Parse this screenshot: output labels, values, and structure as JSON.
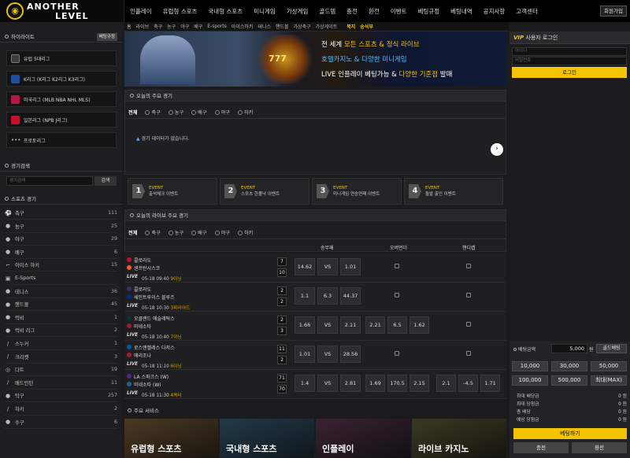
{
  "header": {
    "logo_line1": "ANOTHER",
    "logo_line2": "LEVEL",
    "nav": [
      "인플레이",
      "유럽형 스포츠",
      "국내형 스포츠",
      "미니게임",
      "가상게임",
      "골드뎀",
      "충전",
      "환전",
      "이벤트",
      "베팅규정",
      "베팅내역",
      "공지사항",
      "고객센터"
    ],
    "join_label": "회원가입"
  },
  "subnav": {
    "items": [
      "홈",
      "라이브",
      "축구",
      "농구",
      "야구",
      "배구",
      "E-sports",
      "아이스하키",
      "테니스",
      "핸드볼",
      "가상축구",
      "가상게이트"
    ],
    "highlight": [
      "복지",
      "승석부"
    ]
  },
  "left": {
    "highlight_title": "하이라이트",
    "highlight_badge": "베팅규정",
    "leagues": [
      "유럽 5대리그",
      "K리그 (K리그 K2리그 K3리그)",
      "미국리그 (MLB NBA NHL MLS)",
      "일본리그 (NPB J리그)",
      "프로토리그"
    ],
    "search_title": "경기검색",
    "search_placeholder": "경기검색",
    "search_btn": "검색",
    "sports_title": "스포츠 경기",
    "sports": [
      {
        "name": "축구",
        "count": "111",
        "icon": "⚽"
      },
      {
        "name": "농구",
        "count": "25",
        "icon": "●"
      },
      {
        "name": "야구",
        "count": "29",
        "icon": "●"
      },
      {
        "name": "배구",
        "count": "6",
        "icon": "●"
      },
      {
        "name": "아이스 하키",
        "count": "15",
        "icon": "⌐"
      },
      {
        "name": "E-Sports",
        "count": "",
        "icon": "▣"
      },
      {
        "name": "테니스",
        "count": "36",
        "icon": "●"
      },
      {
        "name": "핸드볼",
        "count": "45",
        "icon": "●"
      },
      {
        "name": "럭비",
        "count": "1",
        "icon": "●"
      },
      {
        "name": "럭비 리그",
        "count": "2",
        "icon": "●"
      },
      {
        "name": "스누커",
        "count": "1",
        "icon": "/"
      },
      {
        "name": "크리켓",
        "count": "3",
        "icon": "/"
      },
      {
        "name": "다트",
        "count": "19",
        "icon": "◎"
      },
      {
        "name": "배드민턴",
        "count": "11",
        "icon": "/"
      },
      {
        "name": "탁구",
        "count": "257",
        "icon": "●"
      },
      {
        "name": "하키",
        "count": "2",
        "icon": "/"
      },
      {
        "name": "수구",
        "count": "6",
        "icon": "●"
      }
    ]
  },
  "banner": {
    "line1_a": "전 세계 ",
    "line1_b": "모든 스포츠 & 정식 라이브",
    "line2": "호텔카지노 & 다양한 미니게임",
    "line3_a": "LIVE 인플레이 ",
    "line3_b": "베팅가능 & ",
    "line3_c": "다양한 기준점",
    "line3_d": " 발매",
    "slot": "777"
  },
  "today": {
    "title": "오늘의 주요 경기",
    "tabs": [
      "전체",
      "축구",
      "농구",
      "배구",
      "야구",
      "하키"
    ],
    "empty": "경기 데이터가 없습니다."
  },
  "events": [
    {
      "num": "1",
      "tag": "EVENT",
      "name": "출석체크 이벤트"
    },
    {
      "num": "2",
      "tag": "EVENT",
      "name": "스포츠 한폴낙 이벤트"
    },
    {
      "num": "3",
      "tag": "EVENT",
      "name": "미니게임 연승연패 이벤트"
    },
    {
      "num": "4",
      "tag": "EVENT",
      "name": "돌발 출인 이벤트"
    }
  ],
  "live": {
    "title": "오늘의 라이브 주요 경기",
    "tabs": [
      "전체",
      "축구",
      "농구",
      "배구",
      "야구",
      "하키"
    ],
    "col_win": "승무패",
    "col_ou": "오버언더",
    "col_hc": "핸디캡",
    "live_label": "LIVE",
    "matches": [
      {
        "home": "콜로라도",
        "away": "샌프란시스코",
        "s1": "7",
        "s2": "10",
        "time": "05-18 09:40",
        "inning": "9이닝",
        "o1": "14.62",
        "o2": "VS",
        "o3": "1.01",
        "ou": [],
        "hc": [],
        "c1": "#c8102e",
        "c2": "#fd5a1e"
      },
      {
        "home": "콜로라도",
        "away": "세인트루이스 블루즈",
        "s1": "2",
        "s2": "2",
        "time": "05-18 10:30",
        "inning": "3피리어드",
        "o1": "1.1",
        "o2": "6.3",
        "o3": "44.37",
        "ou": [],
        "hc": [],
        "c1": "#333366",
        "c2": "#002f87"
      },
      {
        "home": "오클랜드 애슬레틱스",
        "away": "미네소타",
        "s1": "2",
        "s2": "3",
        "time": "05-18 10:40",
        "inning": "7이닝",
        "o1": "1.66",
        "o2": "VS",
        "o3": "2.11",
        "ou": [
          "2.21",
          "6.5",
          "1.62"
        ],
        "hc": [],
        "c1": "#003831",
        "c2": "#9b1c2e"
      },
      {
        "home": "로스앤젤레스 다저스",
        "away": "애리조나",
        "s1": "11",
        "s2": "2",
        "time": "05-18 11:10",
        "inning": "6이닝",
        "o1": "1.01",
        "o2": "VS",
        "o3": "28.56",
        "ou": [],
        "hc": [],
        "c1": "#005a9c",
        "c2": "#a71930"
      },
      {
        "home": "LA 스파크스 (W)",
        "away": "미네소타 (W)",
        "s1": "71",
        "s2": "70",
        "time": "05-18 11:30",
        "inning": "4쿼터",
        "o1": "1.4",
        "o2": "VS",
        "o3": "2.81",
        "ou": [
          "1.69",
          "170.5",
          "2.15"
        ],
        "hc": [
          "2.1",
          "-4.5",
          "1.71"
        ],
        "c1": "#552583",
        "c2": "#236192"
      }
    ]
  },
  "main_service_title": "주요 서비스",
  "tickers": [
    "유럽형 스포츠",
    "국내형 스포츠",
    "인플레이",
    "라이브 카지노"
  ],
  "right": {
    "login_title_vip": "VIP",
    "login_title": " 사용자 로그인",
    "id_placeholder": "아이디",
    "pw_placeholder": "비밀번호",
    "login_btn": "로그인",
    "bet_amount_label": "베팅금액",
    "bet_amount_value": "5,000",
    "bet_amount_unit": "원",
    "gold_btn": "골드베팅",
    "amounts": [
      "10,000",
      "30,000",
      "50,000",
      "100,000",
      "500,000",
      "최대(MAX)"
    ],
    "rows": [
      {
        "label": "최대 배당금",
        "value": "0",
        "unit": "원"
      },
      {
        "label": "최대 당첨금",
        "value": "0",
        "unit": "원"
      },
      {
        "label": "총 배당",
        "value": "0",
        "unit": "원"
      },
      {
        "label": "예상 당첨금",
        "value": "0",
        "unit": "원"
      }
    ],
    "bet_btn": "베팅하기",
    "charge_btn": "충전",
    "withdraw_btn": "환전"
  }
}
